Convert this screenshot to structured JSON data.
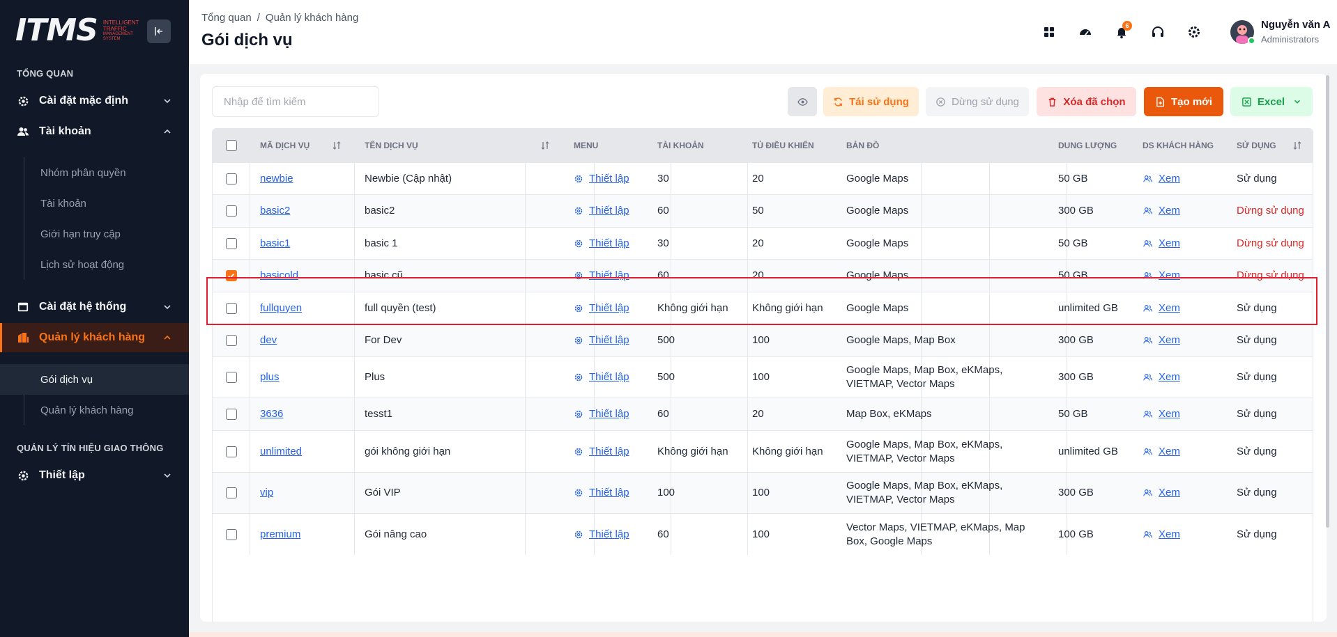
{
  "app": {
    "logo_mark": "ITMS",
    "logo_line1": "INTELLIGENT TRAFFIC",
    "logo_line2": "MANAGEMENT SYSTEM"
  },
  "sidebar": {
    "section_overview": "TỔNG QUAN",
    "section_traffic": "QUẢN LÝ TÍN HIỆU GIAO THÔNG",
    "items": {
      "default_settings": "Cài đặt mặc định",
      "account": "Tài khoản",
      "system_settings": "Cài đặt hệ thống",
      "customer_mgmt": "Quản lý khách hàng",
      "setup": "Thiết lập"
    },
    "account_sub": [
      "Nhóm phân quyền",
      "Tài khoản",
      "Giới hạn truy cập",
      "Lịch sử hoạt động"
    ],
    "customer_sub": [
      "Gói dịch vụ",
      "Quản lý khách hàng"
    ]
  },
  "header": {
    "breadcrumb": [
      "Tổng quan",
      "Quản lý khách hàng"
    ],
    "breadcrumb_sep": "/",
    "title": "Gói dịch vụ",
    "notification_count": "6",
    "user_name": "Nguyễn văn A",
    "user_role": "Administrators"
  },
  "toolbar": {
    "search_placeholder": "Nhập để tìm kiếm",
    "reuse": "Tái sử dụng",
    "stop_use": "Dừng sử dụng",
    "delete_selected": "Xóa đã chọn",
    "create_new": "Tạo mới",
    "excel": "Excel"
  },
  "table": {
    "headers": {
      "code": "MÃ DỊCH VỤ",
      "name": "TÊN DỊCH VỤ",
      "menu": "MENU",
      "accounts": "TÀI KHOẢN",
      "controllers": "TỦ ĐIỀU KHIỂN",
      "maps": "BẢN ĐỒ",
      "storage": "DUNG LƯỢNG",
      "customers": "DS KHÁCH HÀNG",
      "status": "SỬ DỤNG"
    },
    "menu_label": "Thiết lập",
    "view_label": "Xem",
    "rows": [
      {
        "code": "newbie",
        "name": "Newbie (Cập nhật)",
        "accounts": "30",
        "controllers": "20",
        "maps": "Google Maps",
        "storage": "50 GB",
        "status": "Sử dụng",
        "active": true,
        "checked": false
      },
      {
        "code": "basic2",
        "name": "basic2",
        "accounts": "60",
        "controllers": "50",
        "maps": "Google Maps",
        "storage": "300 GB",
        "status": "Dừng sử dụng",
        "active": false,
        "checked": false
      },
      {
        "code": "basic1",
        "name": "basic 1",
        "accounts": "30",
        "controllers": "20",
        "maps": "Google Maps",
        "storage": "50 GB",
        "status": "Dừng sử dụng",
        "active": false,
        "checked": false
      },
      {
        "code": "basicold",
        "name": "basic cũ",
        "accounts": "60",
        "controllers": "20",
        "maps": "Google Maps",
        "storage": "50 GB",
        "status": "Dừng sử dụng",
        "active": false,
        "checked": true
      },
      {
        "code": "fullquyen",
        "name": "full quyền (test)",
        "accounts": "Không giới hạn",
        "controllers": "Không giới hạn",
        "maps": "Google Maps",
        "storage": "unlimited GB",
        "status": "Sử dụng",
        "active": true,
        "checked": false
      },
      {
        "code": "dev",
        "name": "For Dev",
        "accounts": "500",
        "controllers": "100",
        "maps": "Google Maps, Map Box",
        "storage": "300 GB",
        "status": "Sử dụng",
        "active": true,
        "checked": false
      },
      {
        "code": "plus",
        "name": "Plus",
        "accounts": "500",
        "controllers": "100",
        "maps": "Google Maps, Map Box, eKMaps, VIETMAP, Vector Maps",
        "storage": "300 GB",
        "status": "Sử dụng",
        "active": true,
        "checked": false
      },
      {
        "code": "3636",
        "name": "tesst1",
        "accounts": "60",
        "controllers": "20",
        "maps": "Map Box, eKMaps",
        "storage": "50 GB",
        "status": "Sử dụng",
        "active": true,
        "checked": false
      },
      {
        "code": "unlimited",
        "name": "gói không giới hạn",
        "accounts": "Không giới hạn",
        "controllers": "Không giới hạn",
        "maps": "Google Maps, Map Box, eKMaps, VIETMAP, Vector Maps",
        "storage": "unlimited GB",
        "status": "Sử dụng",
        "active": true,
        "checked": false
      },
      {
        "code": "vip",
        "name": "Gói VIP",
        "accounts": "100",
        "controllers": "100",
        "maps": "Google Maps, Map Box, eKMaps, VIETMAP, Vector Maps",
        "storage": "300 GB",
        "status": "Sử dụng",
        "active": true,
        "checked": false
      },
      {
        "code": "premium",
        "name": "Gói nâng cao",
        "accounts": "60",
        "controllers": "100",
        "maps": "Vector Maps, VIETMAP, eKMaps, Map Box, Google Maps",
        "storage": "100 GB",
        "status": "Sử dụng",
        "active": true,
        "checked": false
      }
    ]
  },
  "colors": {
    "accent": "#f97316",
    "sidebar_bg": "#111827",
    "link": "#2563eb",
    "stopped": "#dc2626"
  }
}
